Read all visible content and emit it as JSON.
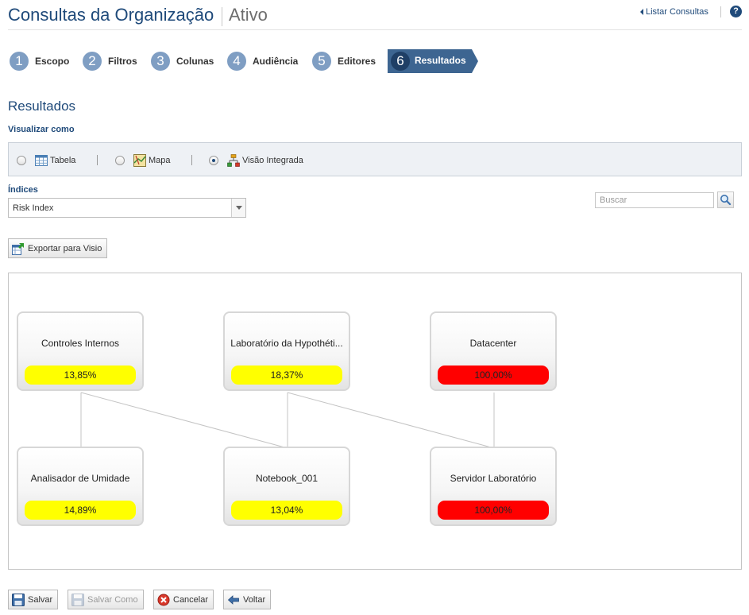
{
  "header": {
    "title": "Consultas da Organização",
    "subtitle": "Ativo",
    "list_link": "Listar Consultas",
    "help_icon": "?"
  },
  "steps": [
    {
      "num": "1",
      "label": "Escopo"
    },
    {
      "num": "2",
      "label": "Filtros"
    },
    {
      "num": "3",
      "label": "Colunas"
    },
    {
      "num": "4",
      "label": "Audiência"
    },
    {
      "num": "5",
      "label": "Editores"
    },
    {
      "num": "6",
      "label": "Resultados",
      "active": true
    }
  ],
  "section_title": "Resultados",
  "view": {
    "label": "Visualizar como",
    "options": [
      {
        "label": "Tabela",
        "icon": "table-icon",
        "selected": false
      },
      {
        "label": "Mapa",
        "icon": "map-icon",
        "selected": false
      },
      {
        "label": "Visão Integrada",
        "icon": "hierarchy-icon",
        "selected": true
      }
    ]
  },
  "indices": {
    "label": "Índices",
    "selected": "Risk Index"
  },
  "search": {
    "placeholder": "Buscar",
    "icon": "search-icon"
  },
  "export_button": "Exportar para Visio",
  "colors": {
    "title": "#1f4a7a",
    "step_inactive": "#7f9ec3",
    "step_active": "#3d6591",
    "pill_yellow": "#ffff00",
    "pill_red": "#ff0000"
  },
  "diagram": {
    "nodes": [
      {
        "name": "Controles Internos",
        "value": "13,85%",
        "status": "yellow"
      },
      {
        "name": "Laboratório da Hypothéti...",
        "value": "18,37%",
        "status": "yellow"
      },
      {
        "name": "Datacenter",
        "value": "100,00%",
        "status": "red"
      },
      {
        "name": "Analisador de Umidade",
        "value": "14,89%",
        "status": "yellow"
      },
      {
        "name": "Notebook_001",
        "value": "13,04%",
        "status": "yellow"
      },
      {
        "name": "Servidor Laboratório",
        "value": "100,00%",
        "status": "red"
      }
    ],
    "links": [
      {
        "from": "Controles Internos",
        "to": "Analisador de Umidade"
      },
      {
        "from": "Controles Internos",
        "to": "Notebook_001"
      },
      {
        "from": "Laboratório da Hypothéti...",
        "to": "Notebook_001"
      },
      {
        "from": "Laboratório da Hypothéti...",
        "to": "Servidor Laboratório"
      },
      {
        "from": "Datacenter",
        "to": "Servidor Laboratório"
      }
    ]
  },
  "footer": {
    "save": "Salvar",
    "save_as": "Salvar Como",
    "cancel": "Cancelar",
    "back": "Voltar"
  }
}
